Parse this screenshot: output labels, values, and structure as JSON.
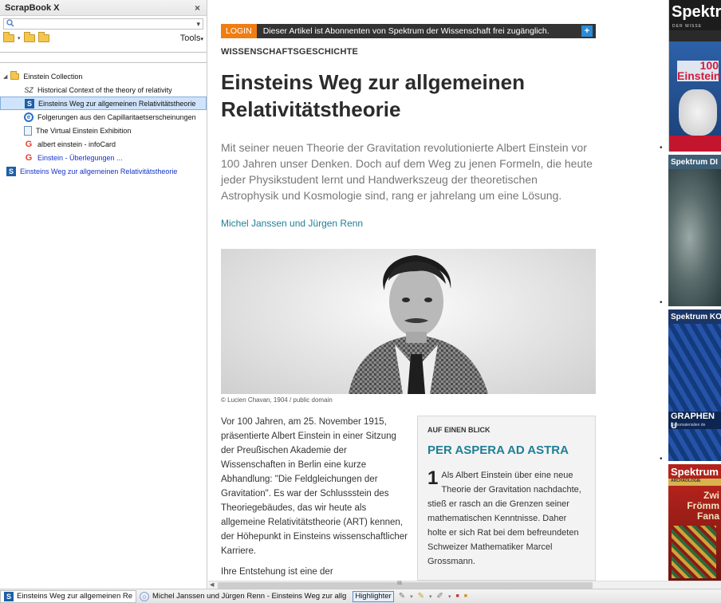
{
  "sidebar": {
    "title": "ScrapBook X",
    "close": "×",
    "tools_label": "Tools",
    "tree": [
      {
        "label": "Einstein Collection",
        "icon": "folder-icon",
        "level": 0
      },
      {
        "label": "Historical Context of the theory of relativity",
        "icon": "sz-icon",
        "level": 1
      },
      {
        "label": "Einsteins Weg zur allgemeinen Relativitätstheorie",
        "icon": "spektrum-s-icon",
        "level": 1,
        "selected": true
      },
      {
        "label": "Folgerungen aus den Capillaritaetserscheinungen",
        "icon": "edge-e-icon",
        "level": 1
      },
      {
        "label": "The Virtual Einstein Exhibition",
        "icon": "page-icon",
        "level": 1
      },
      {
        "label": "albert einstein - infoCard",
        "icon": "google-g-icon",
        "level": 1
      },
      {
        "label": "Einstein - Überlegungen ...",
        "icon": "google-g-icon",
        "level": 1,
        "link": true
      },
      {
        "label": "Einsteins Weg zur allgemeinen Relativitätstheorie",
        "icon": "spektrum-s-icon",
        "level": 0,
        "link": true
      }
    ]
  },
  "article": {
    "login": "LOGIN",
    "login_msg": "Dieser Artikel ist Abonnenten von Spektrum der Wissenschaft frei zugänglich.",
    "kicker": "WISSENSCHAFTSGESCHICHTE",
    "headline": "Einsteins Weg zur allgemeinen Relativitätstheorie",
    "lead": "Mit seiner neuen Theorie der Gravitation revolutionierte Albert Einstein vor 100 Jahren unser Denken. Doch auf dem Weg zu jenen Formeln, die heute jeder Physikstudent lernt und Handwerkszeug der theoretischen Astrophysik und Kosmologie sind, rang er jahrelang um eine Lösung.",
    "authors": "Michel Janssen und Jürgen Renn",
    "credit": "© Lucien Chavan, 1904 / public domain",
    "body": "Vor 100 Jahren, am 25. November 1915, präsentierte Albert Einstein in einer Sitzung der Preußischen Akademie der Wissenschaften in Berlin eine kurze Abhandlung: \"Die Feldgleichungen der Gravitation\". Es war der Schlussstein des Theoriegebäudes, das wir heute als allgemeine Relativitätstheorie (ART) kennen, der Höhepunkt in Einsteins wissenschaftlicher Karriere.",
    "body2": "Ihre Entstehung ist eine der",
    "box_kicker": "AUF EINEN BLICK",
    "box_head": "PER ASPERA AD ASTRA",
    "box_num": "1",
    "box_text": "Als Albert Einstein über eine neue Theorie der Gravitation nachdachte, stieß er rasch an die Grenzen seiner mathematischen Kenntnisse. Daher holte er sich Rat bei dem befreundeten Schweizer Mathematiker Marcel Grossmann."
  },
  "covers": [
    {
      "head": "Spektr",
      "sub": "DER WISSE",
      "big": "100",
      "big2": "Einsteins",
      "color": "#c4152f"
    },
    {
      "head": "Spektrum DI",
      "color": "#3d5e75"
    },
    {
      "head": "Spektrum KON",
      "sub2": "GRAPHEN U",
      "sub3": "Nanomaterialien de",
      "color": "#1b3566"
    },
    {
      "head": "Spektrum",
      "sub": "ARCHÄOLOGIE",
      "big": "Zwi",
      "big2": "Frömm",
      "big3": "Fana",
      "color": "#b3221b"
    }
  ],
  "tabbar": {
    "tab1": "Einsteins Weg zur allgemeinen Re",
    "tab2": "Michel Janssen und Jürgen Renn - Einsteins Weg zur allg",
    "highlighter": "Highlighter"
  },
  "scroll_label": "III"
}
